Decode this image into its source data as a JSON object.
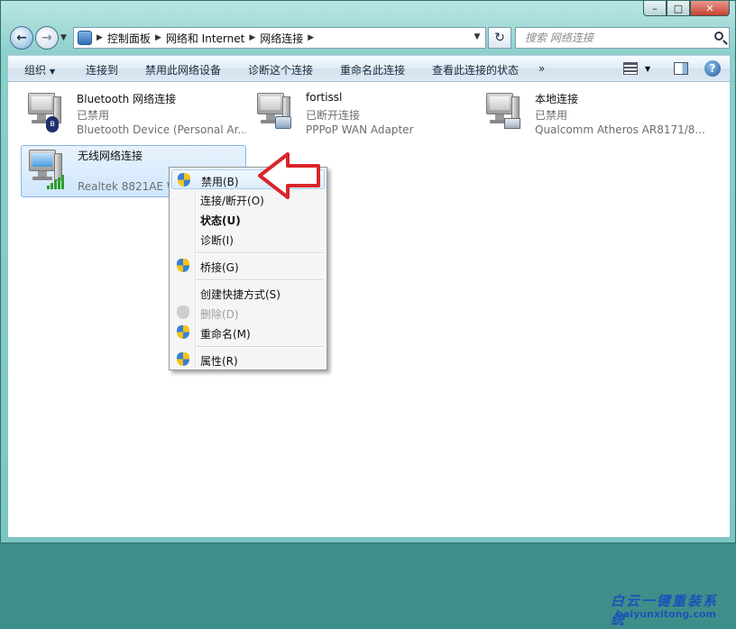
{
  "window": {
    "minimize_glyph": "–",
    "maximize_glyph": "□",
    "close_glyph": "✕"
  },
  "address": {
    "breadcrumbs": [
      "控制面板",
      "网络和 Internet",
      "网络连接"
    ],
    "search_placeholder": "搜索 网络连接"
  },
  "toolbar": {
    "organize": "组织",
    "connect_to": "连接到",
    "disable_device": "禁用此网络设备",
    "diagnose": "诊断这个连接",
    "rename": "重命名此连接",
    "view_status": "查看此连接的状态",
    "more": "»"
  },
  "connections": [
    {
      "name": "Bluetooth 网络连接",
      "status": "已禁用",
      "device": "Bluetooth Device (Personal Ar..."
    },
    {
      "name": "fortissl",
      "status": "已断开连接",
      "device": "PPPoP WAN Adapter"
    },
    {
      "name": "本地连接",
      "status": "已禁用",
      "device": "Qualcomm Atheros AR8171/8..."
    },
    {
      "name": "无线网络连接",
      "status": "",
      "device": "Realtek 8821AE W"
    }
  ],
  "context_menu": {
    "items": [
      {
        "label": "禁用(B)",
        "shield": true,
        "bold": false,
        "disabled": false
      },
      {
        "label": "连接/断开(O)",
        "shield": false,
        "bold": false,
        "disabled": false
      },
      {
        "label": "状态(U)",
        "shield": false,
        "bold": true,
        "disabled": false
      },
      {
        "label": "诊断(I)",
        "shield": false,
        "bold": false,
        "disabled": false
      },
      {
        "label": "桥接(G)",
        "shield": true,
        "bold": false,
        "disabled": false
      },
      {
        "label": "创建快捷方式(S)",
        "shield": false,
        "bold": false,
        "disabled": false
      },
      {
        "label": "删除(D)",
        "shield": true,
        "bold": false,
        "disabled": true
      },
      {
        "label": "重命名(M)",
        "shield": true,
        "bold": false,
        "disabled": false
      },
      {
        "label": "属性(R)",
        "shield": true,
        "bold": false,
        "disabled": false
      }
    ]
  },
  "watermark": {
    "line1": "白云一键重装系统",
    "line2": "baiyunxitong.com"
  },
  "colors": {
    "arrow": "#d9262b",
    "selection": "#cfe6fb",
    "watermark": "#1d52b8"
  }
}
